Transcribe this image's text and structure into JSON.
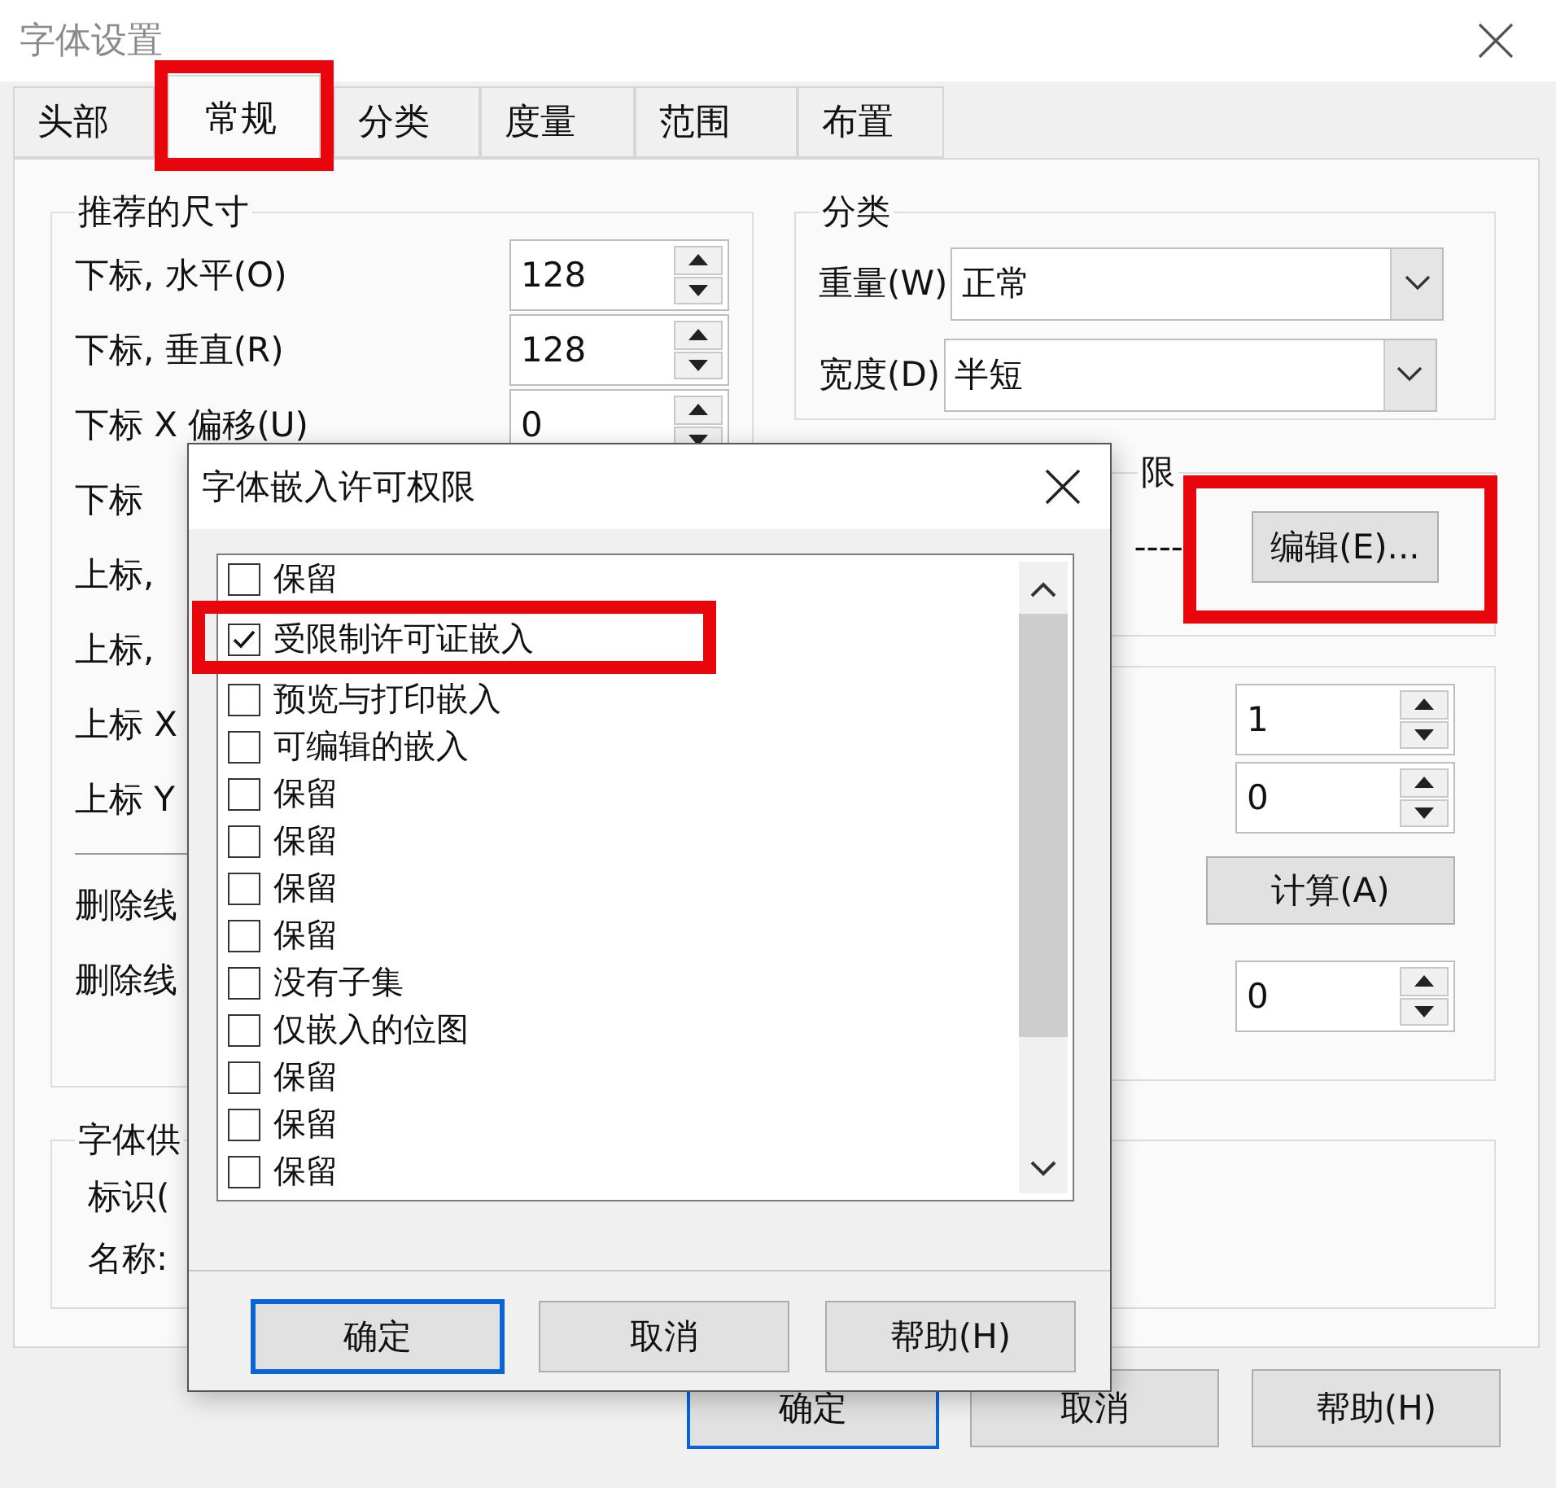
{
  "window": {
    "title": "字体设置"
  },
  "tabs": [
    {
      "label": "头部",
      "selected": false
    },
    {
      "label": "常规",
      "selected": true
    },
    {
      "label": "分类",
      "selected": false
    },
    {
      "label": "度量",
      "selected": false
    },
    {
      "label": "范围",
      "selected": false
    },
    {
      "label": "布置",
      "selected": false
    }
  ],
  "recommended_sizes": {
    "title": "推荐的尺寸",
    "rows": [
      {
        "label": "下标, 水平(O)",
        "value": "128"
      },
      {
        "label": "下标, 垂直(R)",
        "value": "128"
      },
      {
        "label": "下标 X 偏移(U)",
        "value": "0"
      },
      {
        "label": "下标"
      },
      {
        "label": "上标,"
      },
      {
        "label": "上标,"
      },
      {
        "label": "上标 X"
      },
      {
        "label": "上标 Y"
      }
    ],
    "strikeout_rows": [
      {
        "label": "删除线"
      },
      {
        "label": "删除线"
      }
    ]
  },
  "classification": {
    "title": "分类",
    "fields": [
      {
        "label": "重量(W)",
        "value": "正常"
      },
      {
        "label": "宽度(D)",
        "value": "半短"
      }
    ]
  },
  "permissions": {
    "title": "限",
    "leader": "----",
    "button": "编辑(E)..."
  },
  "metrics": {
    "spins": [
      {
        "value": "1"
      },
      {
        "value": "0"
      }
    ],
    "button": "计算(A)",
    "spin_after": {
      "value": "0"
    }
  },
  "vendor": {
    "title": "字体供",
    "rows": [
      "标识(",
      "名称:"
    ]
  },
  "buttons": [
    {
      "label": "确定",
      "default": true
    },
    {
      "label": "取消",
      "default": false
    },
    {
      "label": "帮助(H)",
      "default": false
    }
  ],
  "embed_dialog": {
    "title": "字体嵌入许可权限",
    "items": [
      {
        "label": "保留",
        "checked": false
      },
      {
        "label": "受限制许可证嵌入",
        "checked": true
      },
      {
        "label": "预览与打印嵌入",
        "checked": false
      },
      {
        "label": "可编辑的嵌入",
        "checked": false
      },
      {
        "label": "保留",
        "checked": false
      },
      {
        "label": "保留",
        "checked": false
      },
      {
        "label": "保留",
        "checked": false
      },
      {
        "label": "保留",
        "checked": false
      },
      {
        "label": "没有子集",
        "checked": false
      },
      {
        "label": "仅嵌入的位图",
        "checked": false
      },
      {
        "label": "保留",
        "checked": false
      },
      {
        "label": "保留",
        "checked": false
      },
      {
        "label": "保留",
        "checked": false
      }
    ],
    "buttons": [
      {
        "label": "确定",
        "default": true
      },
      {
        "label": "取消",
        "default": false
      },
      {
        "label": "帮助(H)",
        "default": false
      }
    ]
  }
}
